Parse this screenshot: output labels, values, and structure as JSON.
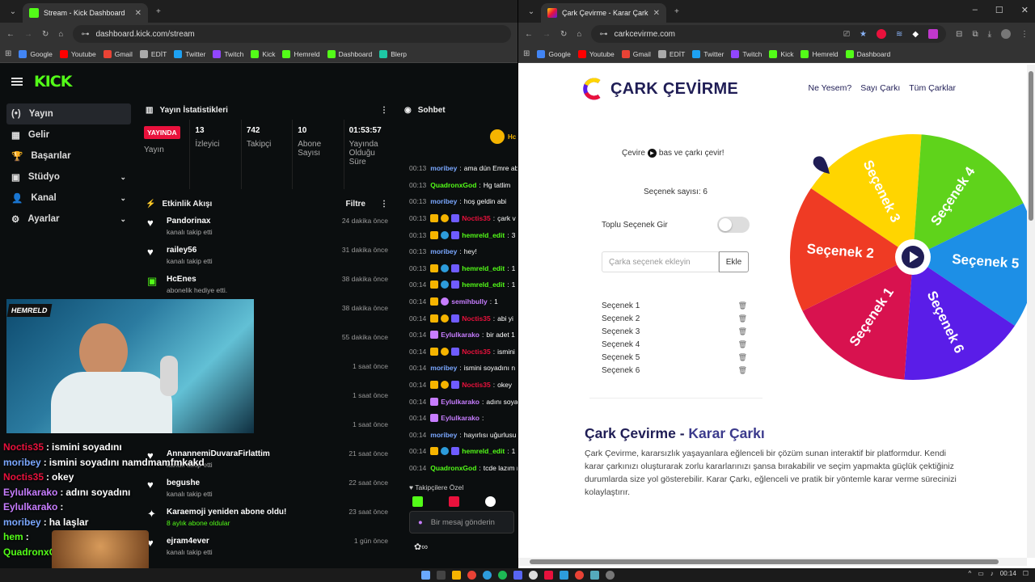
{
  "left": {
    "tab_title": "Stream - Kick Dashboard",
    "url": "dashboard.kick.com/stream",
    "bookmarks": [
      "Google",
      "Youtube",
      "Gmail",
      "EDİT",
      "Twitter",
      "Twitch",
      "Kick",
      "Hemreld",
      "Dashboard",
      "Blerp"
    ],
    "logo": "KICK",
    "sidebar": [
      {
        "label": "Yayın",
        "icon": "(•)"
      },
      {
        "label": "Gelir",
        "icon": "▦"
      },
      {
        "label": "Başarılar",
        "icon": "🏆"
      },
      {
        "label": "Stüdyo",
        "icon": "▣"
      },
      {
        "label": "Kanal",
        "icon": "👤"
      },
      {
        "label": "Ayarlar",
        "icon": "⚙"
      }
    ],
    "stats": {
      "title": "Yayın İstatistikleri",
      "live_badge": "YAYINDA",
      "items": [
        {
          "value": "",
          "label": "Yayın"
        },
        {
          "value": "13",
          "label": "İzleyici"
        },
        {
          "value": "742",
          "label": "Takipçi"
        },
        {
          "value": "10",
          "label": "Abone Sayısı"
        },
        {
          "value": "01:53:57",
          "label": "Yayında Olduğu Süre"
        }
      ]
    },
    "events": {
      "title": "Etkinlik Akışı",
      "filter": "Filtre",
      "items": [
        {
          "name": "Pandorinax",
          "sub": "kanalı takip etti",
          "time": "24 dakika önce",
          "icon": "heart"
        },
        {
          "name": "railey56",
          "sub": "kanalı takip etti",
          "time": "31 dakika önce",
          "icon": "heart"
        },
        {
          "name": "HcEnes",
          "sub": "abonelik hediye etti.",
          "time": "38 dakika önce",
          "icon": "gift"
        },
        {
          "name": "",
          "sub": "a abonelik hediye etti.",
          "time": "38 dakika önce",
          "icon": ""
        },
        {
          "name": "",
          "sub": "",
          "time": "55 dakika önce",
          "icon": ""
        },
        {
          "name": "",
          "sub": "",
          "time": "1 saat önce",
          "icon": ""
        },
        {
          "name": "",
          "sub": "",
          "time": "1 saat önce",
          "icon": ""
        },
        {
          "name": "",
          "sub": "kanalı takip etti",
          "time": "1 saat önce",
          "icon": ""
        },
        {
          "name": "AnnannemiDuvaraFirlattim",
          "sub": "kanalı takip etti",
          "time": "21 saat önce",
          "icon": "heart"
        },
        {
          "name": "begushe",
          "sub": "kanalı takip etti",
          "time": "22 saat önce",
          "icon": "heart"
        },
        {
          "name": "Karaemoji yeniden abone oldu!",
          "sub": "8 aylık abone oldular",
          "time": "23 saat önce",
          "icon": "star"
        },
        {
          "name": "ejram4ever",
          "sub": "kanalı takip etti",
          "time": "1 gün önce",
          "icon": "heart"
        }
      ]
    },
    "chat": {
      "title": "Sohbet",
      "pinned": "Hc",
      "messages": [
        {
          "ts": "00:13",
          "user": "moribey",
          "color": "#7aa7ff",
          "msg": "ama dün Emre ab",
          "badges": []
        },
        {
          "ts": "00:13",
          "user": "QuadronxGod",
          "color": "#53fc18",
          "msg": "Hg tatlim",
          "badges": []
        },
        {
          "ts": "00:13",
          "user": "moribey",
          "color": "#7aa7ff",
          "msg": "hoş geldin abi",
          "badges": []
        },
        {
          "ts": "00:13",
          "user": "Noctis35",
          "color": "#e9113c",
          "msg": "çark v",
          "badges": [
            "#f5b400",
            "#f5b400",
            "#6f5cff"
          ]
        },
        {
          "ts": "00:13",
          "user": "hemreld_edit",
          "color": "#53fc18",
          "msg": "3",
          "badges": [
            "#f5b400",
            "#2d9cdb",
            "#6f5cff"
          ]
        },
        {
          "ts": "00:13",
          "user": "moribey",
          "color": "#7aa7ff",
          "msg": "hey!",
          "badges": []
        },
        {
          "ts": "00:13",
          "user": "hemreld_edit",
          "color": "#53fc18",
          "msg": "1",
          "badges": [
            "#f5b400",
            "#2d9cdb",
            "#6f5cff"
          ]
        },
        {
          "ts": "00:14",
          "user": "hemreld_edit",
          "color": "#53fc18",
          "msg": "1",
          "badges": [
            "#f5b400",
            "#2d9cdb",
            "#6f5cff"
          ]
        },
        {
          "ts": "00:14",
          "user": "semihbully",
          "color": "#c77dff",
          "msg": "1",
          "badges": [
            "#f5b400",
            "#c77dff"
          ]
        },
        {
          "ts": "00:14",
          "user": "Noctis35",
          "color": "#e9113c",
          "msg": "abi yi",
          "badges": [
            "#f5b400",
            "#f5b400",
            "#6f5cff"
          ]
        },
        {
          "ts": "00:14",
          "user": "Eylulkarako",
          "color": "#c77dff",
          "msg": "bir adet 1",
          "badges": [
            "#c77dff"
          ]
        },
        {
          "ts": "00:14",
          "user": "Noctis35",
          "color": "#e9113c",
          "msg": "ismini",
          "badges": [
            "#f5b400",
            "#f5b400",
            "#6f5cff"
          ]
        },
        {
          "ts": "00:14",
          "user": "moribey",
          "color": "#7aa7ff",
          "msg": "ismini soyadını n",
          "badges": []
        },
        {
          "ts": "00:14",
          "user": "Noctis35",
          "color": "#e9113c",
          "msg": "okey",
          "badges": [
            "#f5b400",
            "#f5b400",
            "#6f5cff"
          ]
        },
        {
          "ts": "00:14",
          "user": "Eylulkarako",
          "color": "#c77dff",
          "msg": "adını soya",
          "badges": [
            "#c77dff"
          ]
        },
        {
          "ts": "00:14",
          "user": "Eylulkarako",
          "color": "#c77dff",
          "msg": "",
          "badges": [
            "#c77dff"
          ]
        },
        {
          "ts": "00:14",
          "user": "moribey",
          "color": "#7aa7ff",
          "msg": "hayırlısı uğurlusu",
          "badges": []
        },
        {
          "ts": "00:14",
          "user": "hemreld_edit",
          "color": "#53fc18",
          "msg": "1",
          "badges": [
            "#f5b400",
            "#2d9cdb",
            "#6f5cff"
          ]
        },
        {
          "ts": "00:14",
          "user": "QuadronxGod",
          "color": "#53fc18",
          "msg": "tcde lazım r",
          "badges": []
        }
      ],
      "followers_only": "Takipçilere Özel",
      "placeholder": "Bir mesaj gönderin"
    },
    "cam_label": "HEMRELD",
    "overlay": [
      {
        "user": "Noctis35",
        "color": "#e9113c",
        "msg": "ismini soyadını"
      },
      {
        "user": "moribey",
        "color": "#7aa7ff",
        "msg": "ismini soyadını namdmamfmkakd"
      },
      {
        "user": "Noctis35",
        "color": "#e9113c",
        "msg": "okey"
      },
      {
        "user": "Eylulkarako",
        "color": "#c77dff",
        "msg": "adını soyadını"
      },
      {
        "user": "Eylulkarako",
        "color": "#c77dff",
        "msg": ""
      },
      {
        "user": "moribey",
        "color": "#7aa7ff",
        "msg": "ha                                laşlar"
      },
      {
        "user": "hem",
        "color": "#53fc18",
        "msg": ""
      },
      {
        "user": "QuadronxG",
        "color": "#53fc18",
        "msg": ""
      }
    ]
  },
  "right": {
    "tab_title": "Çark Çevirme - Karar Çarkı",
    "url": "carkcevirme.com",
    "bookmarks": [
      "Google",
      "Youtube",
      "Gmail",
      "EDİT",
      "Twitter",
      "Twitch",
      "Kick",
      "Hemreld",
      "Dashboard"
    ],
    "logo_text": "ÇARK ÇEVİRME",
    "nav": [
      "Ne Yesem?",
      "Sayı Çarkı",
      "Tüm Çarklar"
    ],
    "hint_pre": "Çevire",
    "hint_post": "bas ve çarkı çevir!",
    "count_label": "Seçenek sayısı: 6",
    "bulk_label": "Toplu Seçenek Gir",
    "input_placeholder": "Çarka seçenek ekleyin",
    "add_button": "Ekle",
    "options": [
      "Seçenek 1",
      "Seçenek 2",
      "Seçenek 3",
      "Seçenek 4",
      "Seçenek 5",
      "Seçenek 6"
    ],
    "heading_a": "Çark Çevirme - ",
    "heading_b": "Karar Çarkı",
    "paragraph": "Çark Çevirme, kararsızlık yaşayanlara eğlenceli bir çözüm sunan interaktif bir platformdur. Kendi karar çarkınızı oluşturarak zorlu kararlarınızı şansa bırakabilir ve seçim yapmakta güçlük çektiğiniz durumlarda size yol gösterebilir. Karar Çarkı, eğlenceli ve pratik bir yöntemle karar verme sürecinizi kolaylaştırır.",
    "wheel": [
      {
        "label": "Seçenek 3",
        "color": "#ffd500"
      },
      {
        "label": "Seçenek 4",
        "color": "#5fd31b"
      },
      {
        "label": "Seçenek 5",
        "color": "#1d8fe6"
      },
      {
        "label": "Seçenek 6",
        "color": "#5a1de8"
      },
      {
        "label": "Seçenek 1",
        "color": "#d8124f"
      },
      {
        "label": "Seçenek 2",
        "color": "#ef3b24"
      }
    ]
  },
  "clock": "00:14"
}
